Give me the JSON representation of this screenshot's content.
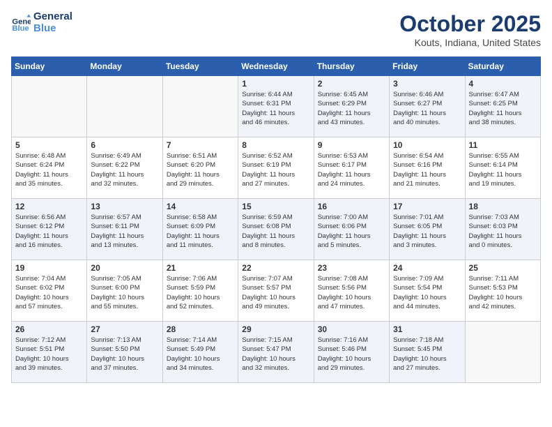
{
  "header": {
    "logo_line1": "General",
    "logo_line2": "Blue",
    "month": "October 2025",
    "location": "Kouts, Indiana, United States"
  },
  "weekdays": [
    "Sunday",
    "Monday",
    "Tuesday",
    "Wednesday",
    "Thursday",
    "Friday",
    "Saturday"
  ],
  "weeks": [
    [
      {
        "day": "",
        "info": ""
      },
      {
        "day": "",
        "info": ""
      },
      {
        "day": "",
        "info": ""
      },
      {
        "day": "1",
        "info": "Sunrise: 6:44 AM\nSunset: 6:31 PM\nDaylight: 11 hours\nand 46 minutes."
      },
      {
        "day": "2",
        "info": "Sunrise: 6:45 AM\nSunset: 6:29 PM\nDaylight: 11 hours\nand 43 minutes."
      },
      {
        "day": "3",
        "info": "Sunrise: 6:46 AM\nSunset: 6:27 PM\nDaylight: 11 hours\nand 40 minutes."
      },
      {
        "day": "4",
        "info": "Sunrise: 6:47 AM\nSunset: 6:25 PM\nDaylight: 11 hours\nand 38 minutes."
      }
    ],
    [
      {
        "day": "5",
        "info": "Sunrise: 6:48 AM\nSunset: 6:24 PM\nDaylight: 11 hours\nand 35 minutes."
      },
      {
        "day": "6",
        "info": "Sunrise: 6:49 AM\nSunset: 6:22 PM\nDaylight: 11 hours\nand 32 minutes."
      },
      {
        "day": "7",
        "info": "Sunrise: 6:51 AM\nSunset: 6:20 PM\nDaylight: 11 hours\nand 29 minutes."
      },
      {
        "day": "8",
        "info": "Sunrise: 6:52 AM\nSunset: 6:19 PM\nDaylight: 11 hours\nand 27 minutes."
      },
      {
        "day": "9",
        "info": "Sunrise: 6:53 AM\nSunset: 6:17 PM\nDaylight: 11 hours\nand 24 minutes."
      },
      {
        "day": "10",
        "info": "Sunrise: 6:54 AM\nSunset: 6:16 PM\nDaylight: 11 hours\nand 21 minutes."
      },
      {
        "day": "11",
        "info": "Sunrise: 6:55 AM\nSunset: 6:14 PM\nDaylight: 11 hours\nand 19 minutes."
      }
    ],
    [
      {
        "day": "12",
        "info": "Sunrise: 6:56 AM\nSunset: 6:12 PM\nDaylight: 11 hours\nand 16 minutes."
      },
      {
        "day": "13",
        "info": "Sunrise: 6:57 AM\nSunset: 6:11 PM\nDaylight: 11 hours\nand 13 minutes."
      },
      {
        "day": "14",
        "info": "Sunrise: 6:58 AM\nSunset: 6:09 PM\nDaylight: 11 hours\nand 11 minutes."
      },
      {
        "day": "15",
        "info": "Sunrise: 6:59 AM\nSunset: 6:08 PM\nDaylight: 11 hours\nand 8 minutes."
      },
      {
        "day": "16",
        "info": "Sunrise: 7:00 AM\nSunset: 6:06 PM\nDaylight: 11 hours\nand 5 minutes."
      },
      {
        "day": "17",
        "info": "Sunrise: 7:01 AM\nSunset: 6:05 PM\nDaylight: 11 hours\nand 3 minutes."
      },
      {
        "day": "18",
        "info": "Sunrise: 7:03 AM\nSunset: 6:03 PM\nDaylight: 11 hours\nand 0 minutes."
      }
    ],
    [
      {
        "day": "19",
        "info": "Sunrise: 7:04 AM\nSunset: 6:02 PM\nDaylight: 10 hours\nand 57 minutes."
      },
      {
        "day": "20",
        "info": "Sunrise: 7:05 AM\nSunset: 6:00 PM\nDaylight: 10 hours\nand 55 minutes."
      },
      {
        "day": "21",
        "info": "Sunrise: 7:06 AM\nSunset: 5:59 PM\nDaylight: 10 hours\nand 52 minutes."
      },
      {
        "day": "22",
        "info": "Sunrise: 7:07 AM\nSunset: 5:57 PM\nDaylight: 10 hours\nand 49 minutes."
      },
      {
        "day": "23",
        "info": "Sunrise: 7:08 AM\nSunset: 5:56 PM\nDaylight: 10 hours\nand 47 minutes."
      },
      {
        "day": "24",
        "info": "Sunrise: 7:09 AM\nSunset: 5:54 PM\nDaylight: 10 hours\nand 44 minutes."
      },
      {
        "day": "25",
        "info": "Sunrise: 7:11 AM\nSunset: 5:53 PM\nDaylight: 10 hours\nand 42 minutes."
      }
    ],
    [
      {
        "day": "26",
        "info": "Sunrise: 7:12 AM\nSunset: 5:51 PM\nDaylight: 10 hours\nand 39 minutes."
      },
      {
        "day": "27",
        "info": "Sunrise: 7:13 AM\nSunset: 5:50 PM\nDaylight: 10 hours\nand 37 minutes."
      },
      {
        "day": "28",
        "info": "Sunrise: 7:14 AM\nSunset: 5:49 PM\nDaylight: 10 hours\nand 34 minutes."
      },
      {
        "day": "29",
        "info": "Sunrise: 7:15 AM\nSunset: 5:47 PM\nDaylight: 10 hours\nand 32 minutes."
      },
      {
        "day": "30",
        "info": "Sunrise: 7:16 AM\nSunset: 5:46 PM\nDaylight: 10 hours\nand 29 minutes."
      },
      {
        "day": "31",
        "info": "Sunrise: 7:18 AM\nSunset: 5:45 PM\nDaylight: 10 hours\nand 27 minutes."
      },
      {
        "day": "",
        "info": ""
      }
    ]
  ]
}
